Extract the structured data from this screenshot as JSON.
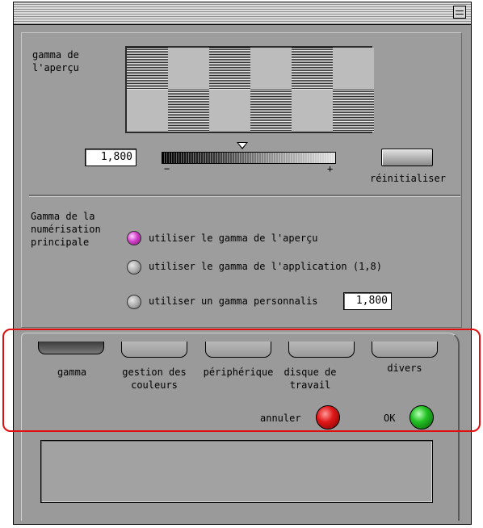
{
  "preview_section": {
    "label": "gamma de\nl'aperçu",
    "value": "1,800",
    "slider_min": "−",
    "slider_max": "+",
    "reset_label": "réinitialiser"
  },
  "main_scan": {
    "label": "Gamma de la\nnumérisation\nprincipale",
    "options": [
      {
        "label": "utiliser le gamma de l'aperçu",
        "selected": true
      },
      {
        "label": "utiliser le gamma de l'application (1,8)",
        "selected": false
      },
      {
        "label": "utiliser un gamma personnalis",
        "selected": false
      }
    ],
    "custom_value": "1,800"
  },
  "tabs": [
    {
      "label": "gamma",
      "selected": true
    },
    {
      "label": "gestion des couleurs",
      "selected": false
    },
    {
      "label": "périphérique",
      "selected": false
    },
    {
      "label": "disque de travail",
      "selected": false
    },
    {
      "label": "divers",
      "selected": false
    }
  ],
  "buttons": {
    "cancel": "annuler",
    "ok": "OK"
  },
  "colors": {
    "cancel": "#e01818",
    "ok": "#22c022",
    "radio_selected": "#d13fc8",
    "highlight": "#e01010"
  }
}
